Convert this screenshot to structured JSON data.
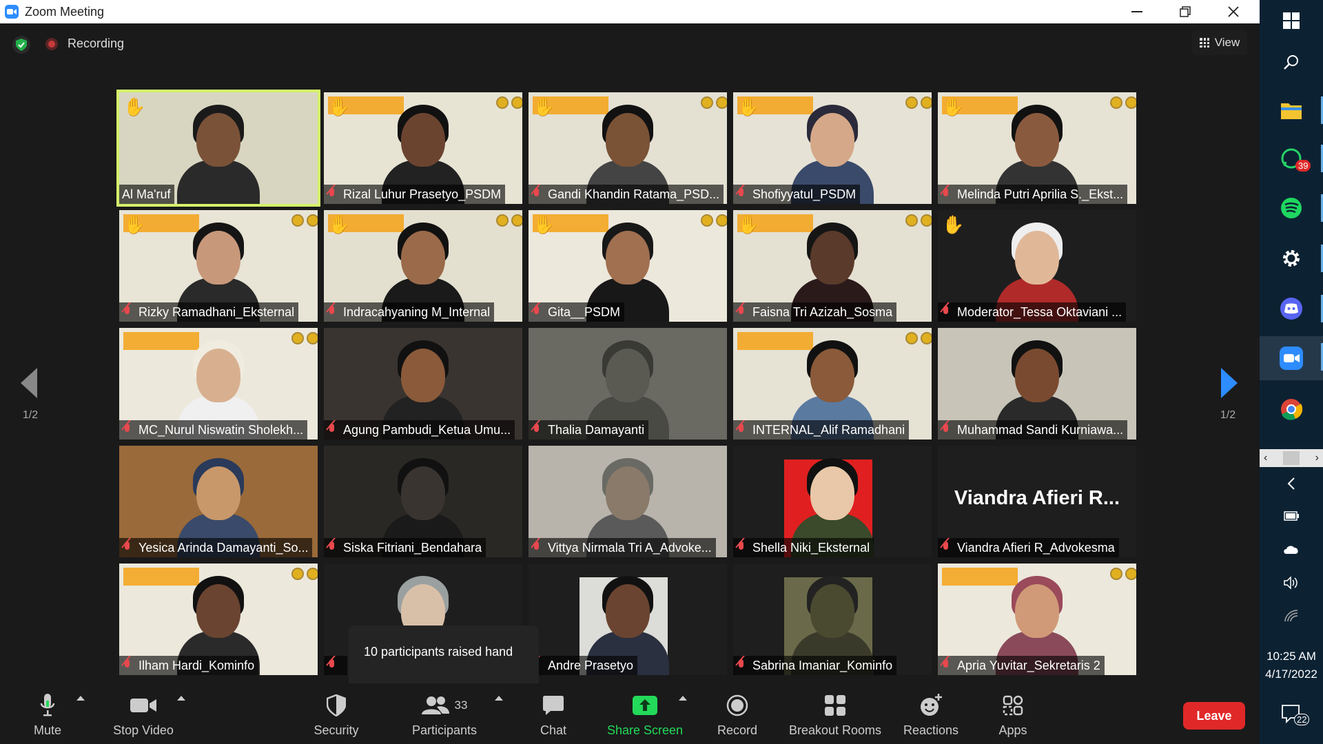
{
  "window": {
    "title": "Zoom Meeting"
  },
  "meeting": {
    "recording_label": "Recording",
    "view_label": "View",
    "page_indicator_left": "1/2",
    "page_indicator_right": "1/2",
    "raised_hands_tooltip": "10 participants raised hand"
  },
  "participants": [
    {
      "name": "Al Ma'ruf",
      "hand": true,
      "active": true,
      "muted": false,
      "bg": "#d8d6c0",
      "skin": "#7a5238",
      "shirt": "#2a2a2a",
      "hair": "#1a1a1a"
    },
    {
      "name": "Rizal Luhur Prasetyo_PSDM",
      "hand": true,
      "muted": true,
      "bg": "#e8e4d4",
      "skin": "#6b4430",
      "shirt": "#222",
      "hair": "#111"
    },
    {
      "name": "Gandi Khandin Ratama_PSD...",
      "hand": true,
      "muted": true,
      "bg": "#e4e0d2",
      "skin": "#7a5236",
      "shirt": "#444",
      "hair": "#111"
    },
    {
      "name": "Shofiyyatul_PSDM",
      "hand": true,
      "muted": true,
      "bg": "#e6e2d6",
      "skin": "#d4a888",
      "shirt": "#3a4a6a",
      "hair": "#2a2a3a"
    },
    {
      "name": "Melinda Putri Aprilia S._Ekst...",
      "hand": true,
      "muted": true,
      "bg": "#e6e2d4",
      "skin": "#8a5a3e",
      "shirt": "#333",
      "hair": "#111"
    },
    {
      "name": "Rizky Ramadhani_Eksternal",
      "hand": true,
      "muted": true,
      "bg": "#e8e4d6",
      "skin": "#c8987a",
      "shirt": "#2a2a2a",
      "hair": "#151515"
    },
    {
      "name": "Indracahyaning M_Internal",
      "hand": true,
      "muted": true,
      "bg": "#e4e0d0",
      "skin": "#9a6a4a",
      "shirt": "#1a1a1a",
      "hair": "#111"
    },
    {
      "name": "Gita__PSDM",
      "hand": true,
      "muted": true,
      "bg": "#ece8dc",
      "skin": "#a07050",
      "shirt": "#181818",
      "hair": "#181818"
    },
    {
      "name": "Faisna Tri Azizah_Sosma",
      "hand": true,
      "muted": true,
      "bg": "#e4e0d2",
      "skin": "#5a3a2a",
      "shirt": "#2a1a1a",
      "hair": "#151515"
    },
    {
      "name": "Moderator_Tessa Oktaviani ...",
      "hand": true,
      "muted": true,
      "bg": "#1e1e1e",
      "skin": "#e0b898",
      "shirt": "#b02a2a",
      "hair": "#eee"
    },
    {
      "name": "MC_Nurul Niswatin Sholekh...",
      "hand": false,
      "muted": true,
      "bg": "#ece8dc",
      "skin": "#d8b090",
      "shirt": "#f0f0f0",
      "hair": "#f0ece0"
    },
    {
      "name": "Agung Pambudi_Ketua Umu...",
      "hand": false,
      "muted": true,
      "bg": "#3a3430",
      "skin": "#8a5a3a",
      "shirt": "#222",
      "hair": "#111"
    },
    {
      "name": "Thalia Damayanti",
      "hand": false,
      "muted": true,
      "bg": "#6a6a62",
      "skin": "#5a5a52",
      "shirt": "#4a4a44",
      "hair": "#3a3a34"
    },
    {
      "name": "INTERNAL_Alif Ramadhani",
      "hand": false,
      "muted": true,
      "bg": "#e6e2d4",
      "skin": "#8a5a3a",
      "shirt": "#5a7aa0",
      "hair": "#111"
    },
    {
      "name": "Muhammad Sandi Kurniawa...",
      "hand": false,
      "muted": true,
      "bg": "#c8c4b8",
      "skin": "#7a4a30",
      "shirt": "#2a2a2a",
      "hair": "#111"
    },
    {
      "name": "Yesica Arinda Damayanti_So...",
      "hand": false,
      "muted": true,
      "bg": "#9a6a3a",
      "skin": "#c8986a",
      "shirt": "#3a4a6a",
      "hair": "#2a3a5a"
    },
    {
      "name": "Siska Fitriani_Bendahara",
      "hand": false,
      "muted": true,
      "bg": "#2a2824",
      "skin": "#3a3430",
      "shirt": "#1a1a1a",
      "hair": "#111"
    },
    {
      "name": "Vittya Nirmala Tri A_Advoke...",
      "hand": false,
      "muted": true,
      "bg": "#b8b4ac",
      "skin": "#8a7a6a",
      "shirt": "#5a5a5a",
      "hair": "#6a6a64"
    },
    {
      "name": "Shella Niki_Eksternal",
      "hand": false,
      "muted": true,
      "bg": "#1e1e1e",
      "skin": "#e8c8a8",
      "shirt": "#3a4a2a",
      "hair": "#111",
      "frame": "#e02020"
    },
    {
      "name": "Viandra Afieri R_Advokesma",
      "hand": false,
      "muted": true,
      "bg": "#1e1e1e",
      "big_name": "Viandra Afieri R..."
    },
    {
      "name": "Ilham Hardi_Kominfo",
      "hand": false,
      "muted": true,
      "bg": "#ece8dc",
      "skin": "#6a4430",
      "shirt": "#2a2a2a",
      "hair": "#111"
    },
    {
      "name": "",
      "hand": false,
      "muted": true,
      "bg": "#1e1e1e",
      "skin": "#d8c0a8",
      "shirt": "#1e1e1e",
      "hair": "#9aa0a0"
    },
    {
      "name": "Andre Prasetyo",
      "hand": false,
      "muted": true,
      "bg": "#1e1e1e",
      "skin": "#6a4430",
      "shirt": "#2a3040",
      "hair": "#111",
      "frame": "#dcdcd8"
    },
    {
      "name": "Sabrina Imaniar_Kominfo",
      "hand": false,
      "muted": true,
      "bg": "#1e1e1e",
      "skin": "#4a4a30",
      "shirt": "#3a3a2a",
      "hair": "#222",
      "frame": "#6a6a4a"
    },
    {
      "name": "Apria Yuvitar_Sekretaris 2",
      "hand": false,
      "muted": true,
      "bg": "#ece8dc",
      "skin": "#d09a78",
      "shirt": "#8a4a5a",
      "hair": "#9a4a5a"
    }
  ],
  "toolbar": {
    "mute": "Mute",
    "stop_video": "Stop Video",
    "security": "Security",
    "participants": "Participants",
    "participants_count": "33",
    "chat": "Chat",
    "share_screen": "Share Screen",
    "record": "Record",
    "breakout_rooms": "Breakout Rooms",
    "reactions": "Reactions",
    "apps": "Apps",
    "leave": "Leave"
  },
  "taskbar": {
    "whatsapp_badge": "39",
    "time": "10:25 AM",
    "date": "4/17/2022",
    "notifications_count": "22"
  },
  "colors": {
    "accent": "#2d8cff",
    "active_speaker": "#d4f26a",
    "leave": "#e02828",
    "share": "#23d959"
  }
}
